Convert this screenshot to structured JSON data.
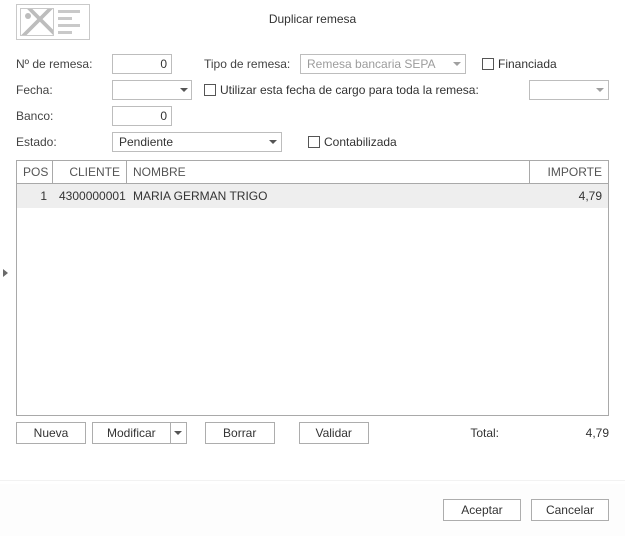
{
  "title": "Duplicar remesa",
  "labels": {
    "nRemesa": "Nº de remesa:",
    "tipoRemesa": "Tipo de remesa:",
    "financiada": "Financiada",
    "fecha": "Fecha:",
    "usarFecha": "Utilizar esta fecha de cargo para toda la remesa:",
    "banco": "Banco:",
    "estado": "Estado:",
    "contabilizada": "Contabilizada",
    "total": "Total:"
  },
  "fields": {
    "nRemesa": "0",
    "tipoRemesa": "Remesa bancaria SEPA",
    "fecha": "",
    "banco": "0",
    "estado": "Pendiente",
    "fechaCargo": ""
  },
  "columns": {
    "pos": "POS",
    "cliente": "CLIENTE",
    "nombre": "NOMBRE",
    "importe": "IMPORTE"
  },
  "rows": [
    {
      "pos": "1",
      "cliente": "4300000001",
      "nombre": "MARIA GERMAN TRIGO",
      "importe": "4,79"
    }
  ],
  "total": "4,79",
  "buttons": {
    "nueva": "Nueva",
    "modificar": "Modificar",
    "borrar": "Borrar",
    "validar": "Validar",
    "aceptar": "Aceptar",
    "cancelar": "Cancelar"
  }
}
